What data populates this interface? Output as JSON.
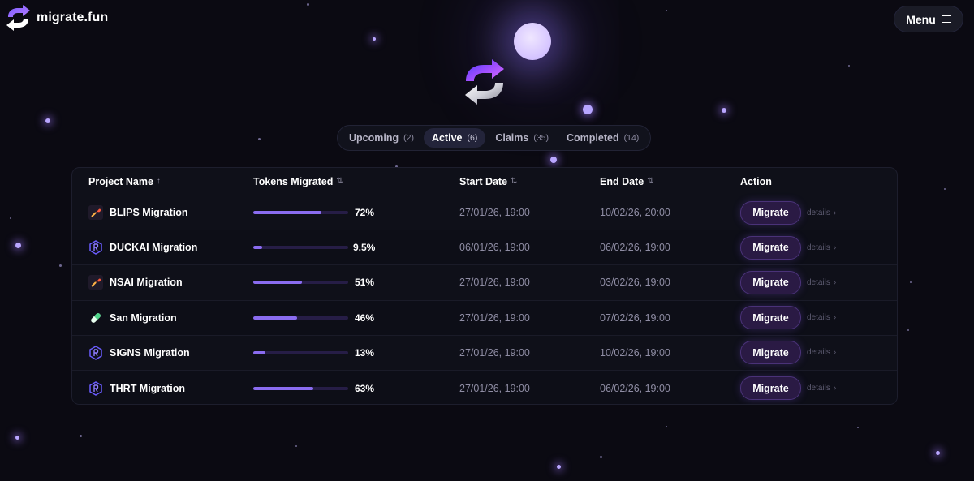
{
  "brand": {
    "name": "migrate.fun"
  },
  "header": {
    "menu_label": "Menu"
  },
  "tabs": [
    {
      "label": "Upcoming",
      "count": "(2)"
    },
    {
      "label": "Active",
      "count": "(6)"
    },
    {
      "label": "Claims",
      "count": "(35)"
    },
    {
      "label": "Completed",
      "count": "(14)"
    }
  ],
  "table": {
    "headers": {
      "project": "Project Name",
      "project_sort": "↑",
      "tokens": "Tokens Migrated",
      "tokens_sort": "⇅",
      "start": "Start Date",
      "start_sort": "⇅",
      "end": "End Date",
      "end_sort": "⇅",
      "action": "Action"
    },
    "rows": [
      {
        "name": "BLIPS Migration",
        "icon": "bonk-icon",
        "progress": 72,
        "pct": "72%",
        "start": "27/01/26, 19:00",
        "end": "10/02/26, 20:00",
        "button": "Migrate",
        "details": "details"
      },
      {
        "name": "DUCKAI Migration",
        "icon": "raydium-icon",
        "progress": 9.5,
        "pct": "9.5%",
        "start": "06/01/26, 19:00",
        "end": "06/02/26, 19:00",
        "button": "Migrate",
        "details": "details"
      },
      {
        "name": "NSAI Migration",
        "icon": "bonk-icon",
        "progress": 51,
        "pct": "51%",
        "start": "27/01/26, 19:00",
        "end": "03/02/26, 19:00",
        "button": "Migrate",
        "details": "details"
      },
      {
        "name": "San Migration",
        "icon": "pill-icon",
        "progress": 46,
        "pct": "46%",
        "start": "27/01/26, 19:00",
        "end": "07/02/26, 19:00",
        "button": "Migrate",
        "details": "details"
      },
      {
        "name": "SIGNS Migration",
        "icon": "raydium-icon",
        "progress": 13,
        "pct": "13%",
        "start": "27/01/26, 19:00",
        "end": "10/02/26, 19:00",
        "button": "Migrate",
        "details": "details"
      },
      {
        "name": "THRT Migration",
        "icon": "raydium-icon",
        "progress": 63,
        "pct": "63%",
        "start": "27/01/26, 19:00",
        "end": "06/02/26, 19:00",
        "button": "Migrate",
        "details": "details"
      }
    ]
  },
  "colors": {
    "accent": "#8a6cf0",
    "background": "#0b0a12",
    "button_bg": "#2a1a44"
  }
}
